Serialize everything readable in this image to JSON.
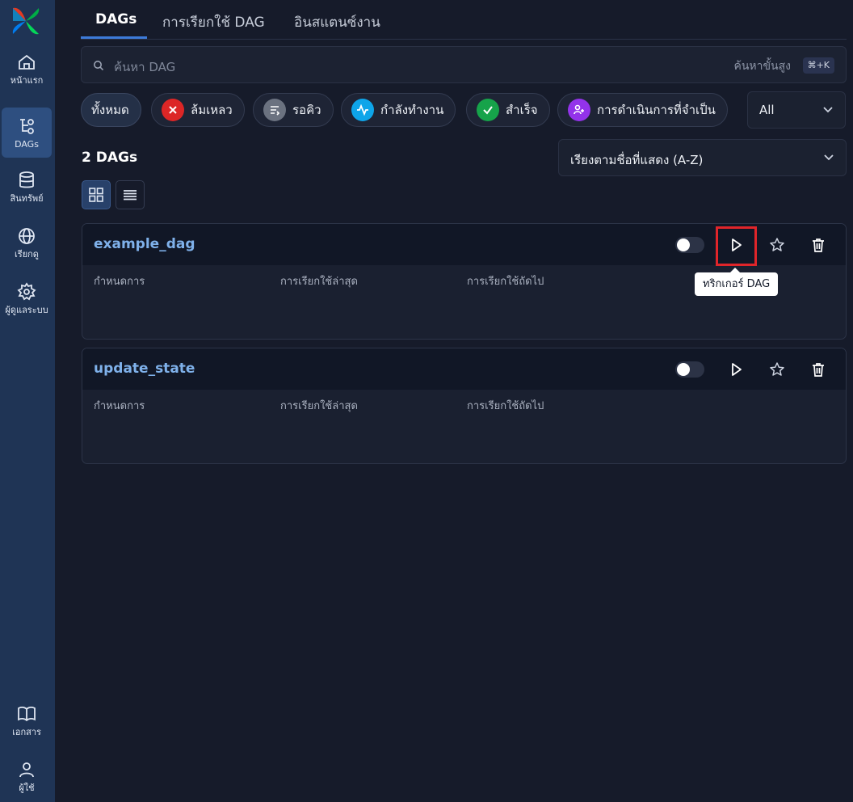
{
  "sidebar": {
    "items": [
      {
        "label": "หน้าแรก",
        "icon": "home-icon"
      },
      {
        "label": "DAGs",
        "icon": "dag-icon"
      },
      {
        "label": "สินทรัพย์",
        "icon": "database-icon"
      },
      {
        "label": "เรียกดู",
        "icon": "globe-icon"
      },
      {
        "label": "ผู้ดูแลระบบ",
        "icon": "gear-icon"
      }
    ],
    "bottom": [
      {
        "label": "เอกสาร",
        "icon": "book-icon"
      },
      {
        "label": "ผู้ใช้",
        "icon": "user-icon"
      }
    ]
  },
  "tabs": [
    "DAGs",
    "การเรียกใช้ DAG",
    "อินสแตนซ์งาน"
  ],
  "search": {
    "placeholder": "ค้นหา DAG",
    "advanced": "ค้นหาขั้นสูง",
    "shortcut": "⌘+K"
  },
  "filters": [
    {
      "label": "ทั้งหมด"
    },
    {
      "label": "ล้มเหลว",
      "icon": "x-icon",
      "color": "#dc2626"
    },
    {
      "label": "รอคิว",
      "icon": "queue-icon",
      "color": "#6b7280"
    },
    {
      "label": "กำลังทำงาน",
      "icon": "activity-icon",
      "color": "#0ea5e9"
    },
    {
      "label": "สำเร็จ",
      "icon": "check-icon",
      "color": "#16a34a"
    },
    {
      "label": "การดำเนินการที่จำเป็น",
      "icon": "action-required-icon",
      "color": "#9333ea"
    }
  ],
  "tag_filter": "All",
  "dag_count": "2 DAGs",
  "sort": "เรียงตามชื่อที่แสดง (A-Z)",
  "columns": {
    "schedule": "กำหนดการ",
    "last_run": "การเรียกใช้ล่าสุด",
    "next_run": "การเรียกใช้ถัดไป"
  },
  "dags": [
    {
      "name": "example_dag",
      "paused": true
    },
    {
      "name": "update_state",
      "paused": true
    }
  ],
  "tooltip": "ทริกเกอร์ DAG",
  "colors": {
    "accent": "#3d7bd9",
    "highlight": "#e0252a",
    "dag_name": "#7fb1ea"
  }
}
